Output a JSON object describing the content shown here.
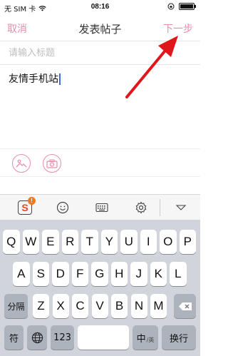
{
  "status_bar": {
    "carrier": "无 SIM 卡",
    "time": "08:16"
  },
  "nav": {
    "cancel": "取消",
    "title": "发表帖子",
    "next": "下一步"
  },
  "title_field": {
    "placeholder": "请输入标题",
    "value": ""
  },
  "body": {
    "text": "友情手机站"
  },
  "media": {
    "photo_icon": "image-icon",
    "camera_icon": "camera-icon"
  },
  "keyboard_toolbar": {
    "logo": "S",
    "badge": "!",
    "items": [
      "emoji-icon",
      "keyboard-icon",
      "gear-icon",
      "collapse-icon"
    ]
  },
  "keyboard": {
    "row1": [
      "Q",
      "W",
      "E",
      "R",
      "T",
      "Y",
      "U",
      "I",
      "O",
      "P"
    ],
    "row2": [
      "A",
      "S",
      "D",
      "F",
      "G",
      "H",
      "J",
      "K",
      "L"
    ],
    "row3": [
      "Z",
      "X",
      "C",
      "V",
      "B",
      "N",
      "M"
    ],
    "shift_label": "分隔",
    "symbols_label": "符",
    "numbers_label": "123",
    "lang_label": "中",
    "lang_sub": "/英",
    "return_label": "换行",
    "space_label": ""
  },
  "colors": {
    "accent": "#e98ea8",
    "arrow": "#e0161b",
    "keyboard_bg": "#d1d5db"
  }
}
